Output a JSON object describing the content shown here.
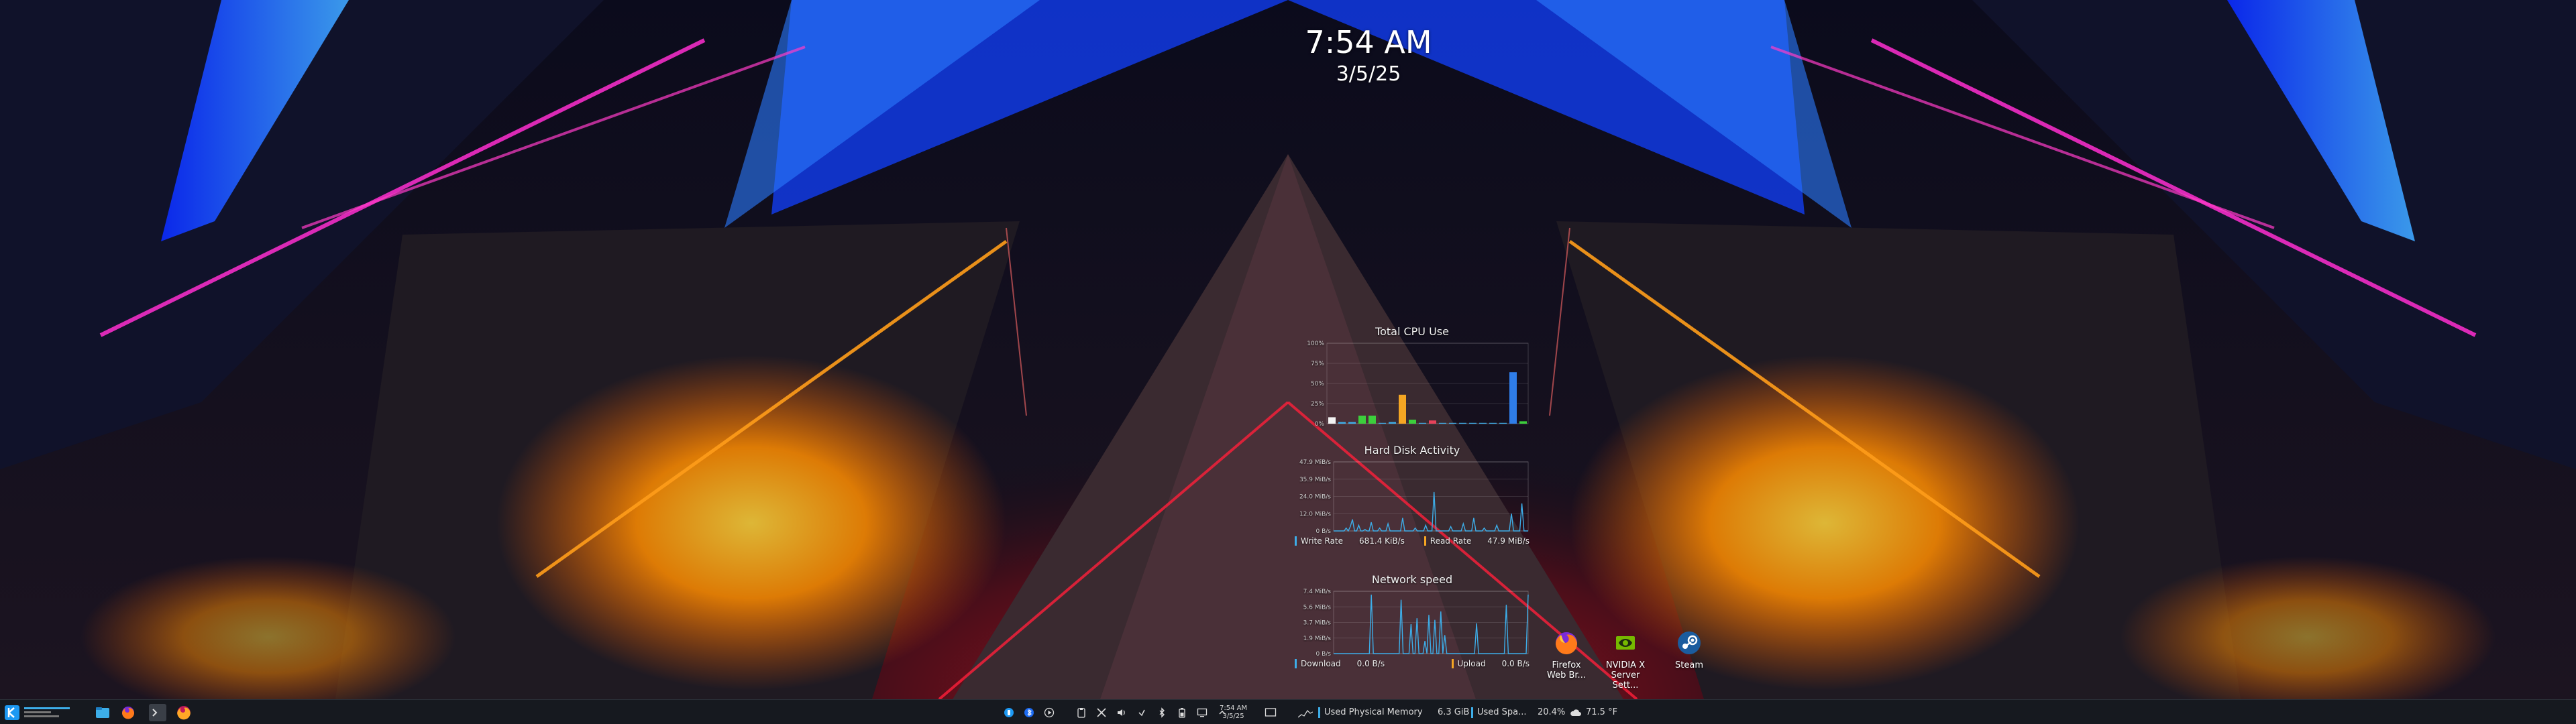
{
  "clock": {
    "time": "7:54 AM",
    "date": "3/5/25"
  },
  "cpu": {
    "title": "Total CPU Use",
    "y_ticks": [
      "100%",
      "75%",
      "50%",
      "25%",
      "0%"
    ],
    "bars": [
      {
        "value": 8,
        "color": "#f2f2f2"
      },
      {
        "value": 2,
        "color": "#3daee9"
      },
      {
        "value": 2,
        "color": "#3daee9"
      },
      {
        "value": 10,
        "color": "#3ccf3c"
      },
      {
        "value": 10,
        "color": "#3ccf3c"
      },
      {
        "value": 1,
        "color": "#3daee9"
      },
      {
        "value": 2,
        "color": "#3daee9"
      },
      {
        "value": 36,
        "color": "#f5a623"
      },
      {
        "value": 5,
        "color": "#3ccf3c"
      },
      {
        "value": 1,
        "color": "#3daee9"
      },
      {
        "value": 4,
        "color": "#e8425a"
      },
      {
        "value": 1,
        "color": "#3daee9"
      },
      {
        "value": 1,
        "color": "#3daee9"
      },
      {
        "value": 1,
        "color": "#3daee9"
      },
      {
        "value": 1,
        "color": "#3daee9"
      },
      {
        "value": 1,
        "color": "#3daee9"
      },
      {
        "value": 1,
        "color": "#3daee9"
      },
      {
        "value": 1,
        "color": "#3daee9"
      },
      {
        "value": 64,
        "color": "#2f7de8"
      },
      {
        "value": 3,
        "color": "#3ccf3c"
      }
    ]
  },
  "disk": {
    "title": "Hard Disk Activity",
    "y_ticks": [
      "47.9 MiB/s",
      "35.9 MiB/s",
      "24.0 MiB/s",
      "12.0 MiB/s",
      "0 B/s"
    ],
    "ymax": 47.9,
    "series": [
      0,
      0,
      0,
      0,
      0,
      0,
      2,
      0,
      3,
      8,
      0,
      0,
      4,
      0,
      0,
      1,
      0,
      0,
      6,
      0,
      0,
      0,
      2,
      0,
      0,
      0,
      5,
      0,
      0,
      0,
      0,
      0,
      0,
      9,
      0,
      0,
      0,
      0,
      0,
      2,
      0,
      0,
      0,
      0,
      4,
      0,
      0,
      0,
      27,
      0,
      0,
      0,
      0,
      0,
      0,
      0,
      3,
      0,
      0,
      0,
      0,
      0,
      5,
      0,
      0,
      0,
      0,
      9,
      0,
      0,
      0,
      0,
      2,
      0,
      0,
      0,
      0,
      0,
      4,
      0,
      0,
      0,
      0,
      0,
      0,
      12,
      0,
      0,
      0,
      0,
      19,
      0,
      0,
      0
    ],
    "legend": [
      {
        "label": "Write Rate",
        "value": "681.4 KiB/s",
        "color": "#3daee9"
      },
      {
        "label": "Read Rate",
        "value": "47.9 MiB/s",
        "color": "#f5a623"
      }
    ]
  },
  "network": {
    "title": "Network speed",
    "y_ticks": [
      "7.4 MiB/s",
      "5.6 MiB/s",
      "3.7 MiB/s",
      "1.9 MiB/s",
      "0 B/s"
    ],
    "ymax": 7.4,
    "series": [
      0,
      0,
      0,
      0,
      0,
      0,
      0,
      0,
      0,
      0,
      0,
      0,
      0,
      0,
      0,
      0,
      0,
      0,
      0,
      7.0,
      0,
      0,
      0,
      0,
      0,
      0,
      0,
      0,
      0,
      0,
      0,
      0,
      0,
      0,
      6.4,
      0,
      0,
      0,
      0,
      3.5,
      0,
      0,
      4.2,
      0,
      0,
      0,
      1.5,
      0,
      4.6,
      0,
      0,
      4.0,
      0,
      0,
      5.0,
      0,
      2.2,
      0,
      0,
      0,
      0,
      0,
      0,
      0,
      0,
      0,
      0,
      0,
      0,
      0,
      0,
      0,
      3.6,
      0,
      0,
      0,
      0,
      0,
      0,
      0,
      0,
      0,
      0,
      0,
      0,
      0,
      0,
      5.8,
      0,
      0,
      0,
      0,
      0,
      0,
      0,
      0,
      0,
      0,
      7.0
    ],
    "legend": [
      {
        "label": "Download",
        "value": "0.0 B/s",
        "color": "#3daee9"
      },
      {
        "label": "Upload",
        "value": "0.0 B/s",
        "color": "#f5a623"
      }
    ]
  },
  "desktop_icons": [
    {
      "label1": "Firefox",
      "label2": "Web Br...",
      "icon": "firefox-icon"
    },
    {
      "label1": "NVIDIA X",
      "label2": "Server Sett...",
      "icon": "nvidia-icon"
    },
    {
      "label1": "Steam",
      "label2": "",
      "icon": "steam-icon"
    }
  ],
  "taskbar": {
    "clock_time": "7:54 AM",
    "clock_date": "3/5/25",
    "memory_label": "Used Physical Memory",
    "memory_value": "6.3 GiB",
    "swap_label": "Used Spa...",
    "cpu_percent": "20.4%",
    "temperature": "71.5 °F",
    "tray_icons": [
      "kde-connect-icon",
      "bluetooth-icon",
      "media-player-icon",
      "clipboard-icon",
      "network-tool-icon",
      "volume-icon",
      "vpn-icon",
      "bluetooth-tray-icon",
      "battery-icon",
      "display-icon",
      "expand-tray-icon"
    ]
  }
}
